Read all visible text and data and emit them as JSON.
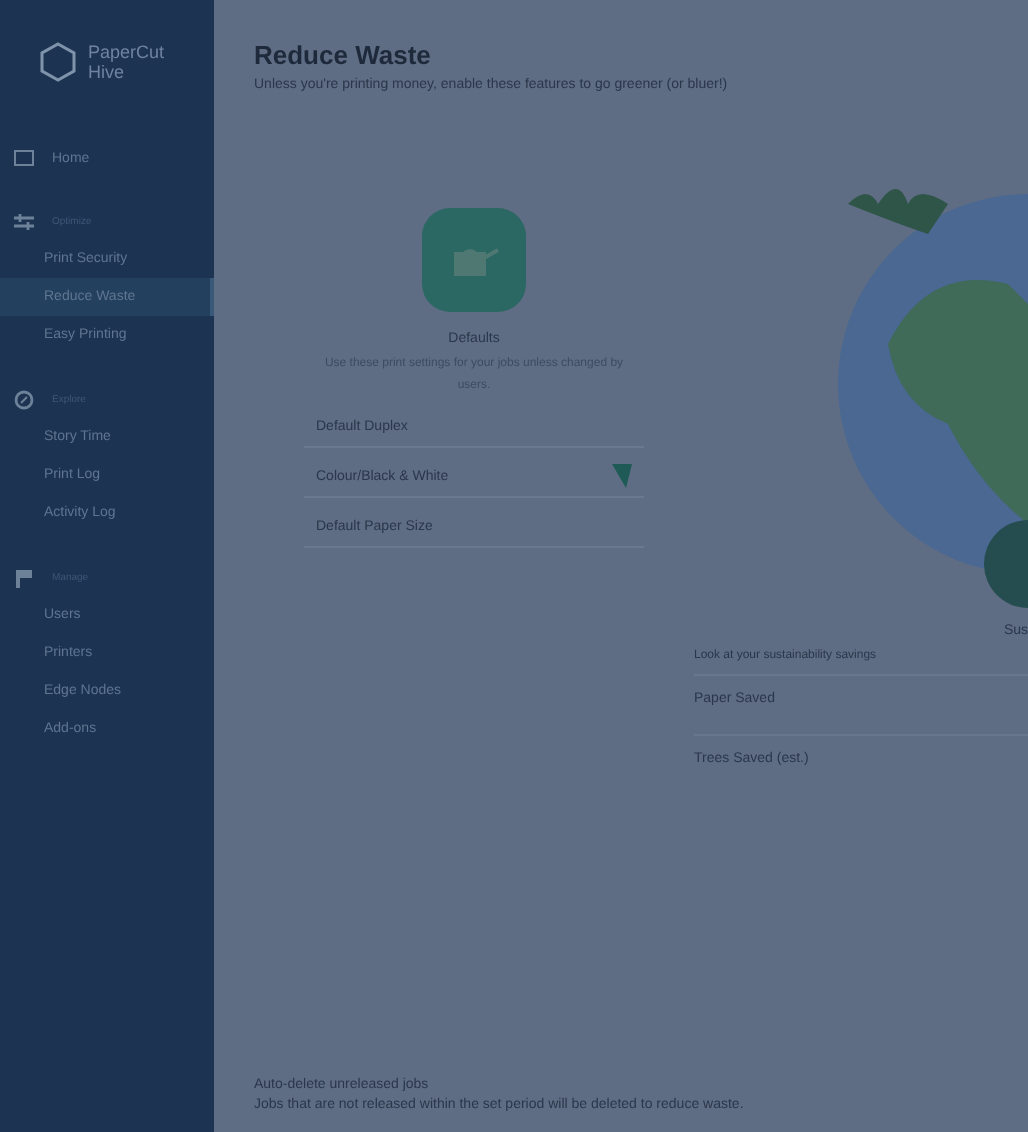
{
  "sidebar": {
    "logo": "PaperCut",
    "product": "Hive",
    "sections": [
      {
        "kind": "link",
        "label": "Home"
      },
      {
        "kind": "group",
        "label": "Optimize",
        "items": [
          {
            "label": "Print Security",
            "selected": false
          },
          {
            "label": "Reduce Waste",
            "selected": true
          },
          {
            "label": "Easy Printing",
            "selected": false
          }
        ]
      },
      {
        "kind": "group",
        "label": "Explore",
        "items": [
          {
            "label": "Story Time",
            "selected": false
          },
          {
            "label": "Print Log",
            "selected": false
          },
          {
            "label": "Activity Log",
            "selected": false
          }
        ]
      },
      {
        "kind": "group",
        "label": "Manage",
        "items": [
          {
            "label": "Users",
            "selected": false
          },
          {
            "label": "Printers",
            "selected": false
          },
          {
            "label": "Edge Nodes",
            "selected": false
          },
          {
            "label": "Add-ons",
            "selected": false
          }
        ]
      }
    ]
  },
  "page": {
    "title": "Reduce Waste",
    "subtitle": "Unless you're printing money, enable these features to go greener (or bluer!)"
  },
  "left_card": {
    "title": "Defaults",
    "description": "Use these print settings for your jobs unless changed by users.",
    "fields": [
      {
        "label": "Default Duplex",
        "dropdown": false
      },
      {
        "label": "Colour/Black & White",
        "dropdown": true
      },
      {
        "label": "Default Paper Size",
        "dropdown": false
      }
    ]
  },
  "right_card": {
    "caption": "Sus",
    "description": "Look at your sustainability savings",
    "fields": [
      {
        "label": "Paper Saved"
      },
      {
        "label": "Trees Saved (est.)"
      }
    ]
  },
  "footer": {
    "line_1": "Auto-delete unreleased jobs",
    "line_2": "Jobs that are not released within the set period will be deleted to reduce waste."
  }
}
